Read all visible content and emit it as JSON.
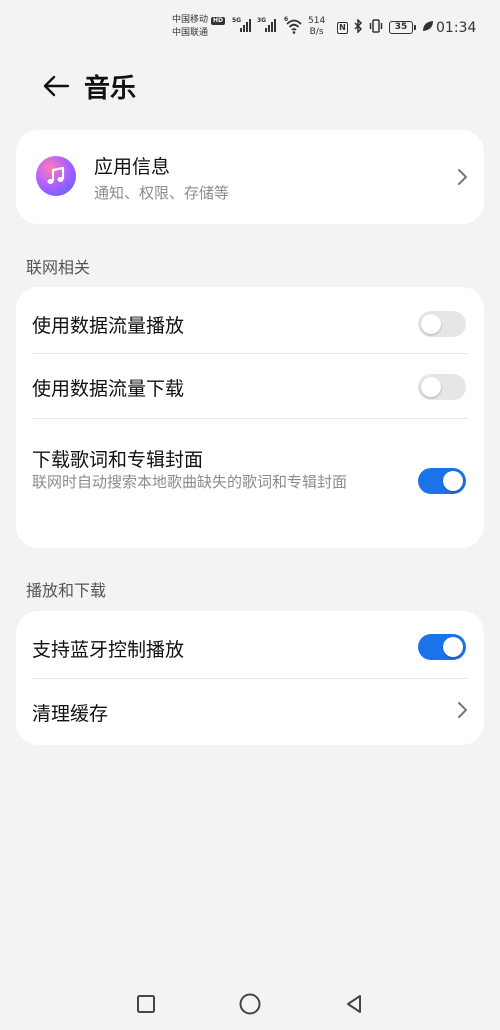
{
  "status_bar": {
    "carrier1": "中国移动",
    "carrier1_badge": "HD",
    "carrier2": "中国联通",
    "signal1_gen": "5G",
    "signal2_gen": "3G",
    "wifi_gen": "6",
    "speed_value": "514",
    "speed_unit": "B/s",
    "nfc_label": "N",
    "battery_level": "35",
    "time": "01:34"
  },
  "header": {
    "title": "音乐"
  },
  "app_info": {
    "title": "应用信息",
    "subtitle": "通知、权限、存储等"
  },
  "network_section": {
    "label": "联网相关",
    "items": [
      {
        "title": "使用数据流量播放",
        "enabled": false
      },
      {
        "title": "使用数据流量下载",
        "enabled": false
      },
      {
        "title": "下载歌词和专辑封面",
        "subtitle": "联网时自动搜索本地歌曲缺失的歌词和专辑封面",
        "enabled": true
      }
    ]
  },
  "playback_section": {
    "label": "播放和下载",
    "items": [
      {
        "title": "支持蓝牙控制播放",
        "enabled": true
      },
      {
        "title": "清理缓存"
      }
    ]
  },
  "colors": {
    "accent": "#1b73ea",
    "background": "#f1f3f5",
    "card": "#ffffff"
  }
}
